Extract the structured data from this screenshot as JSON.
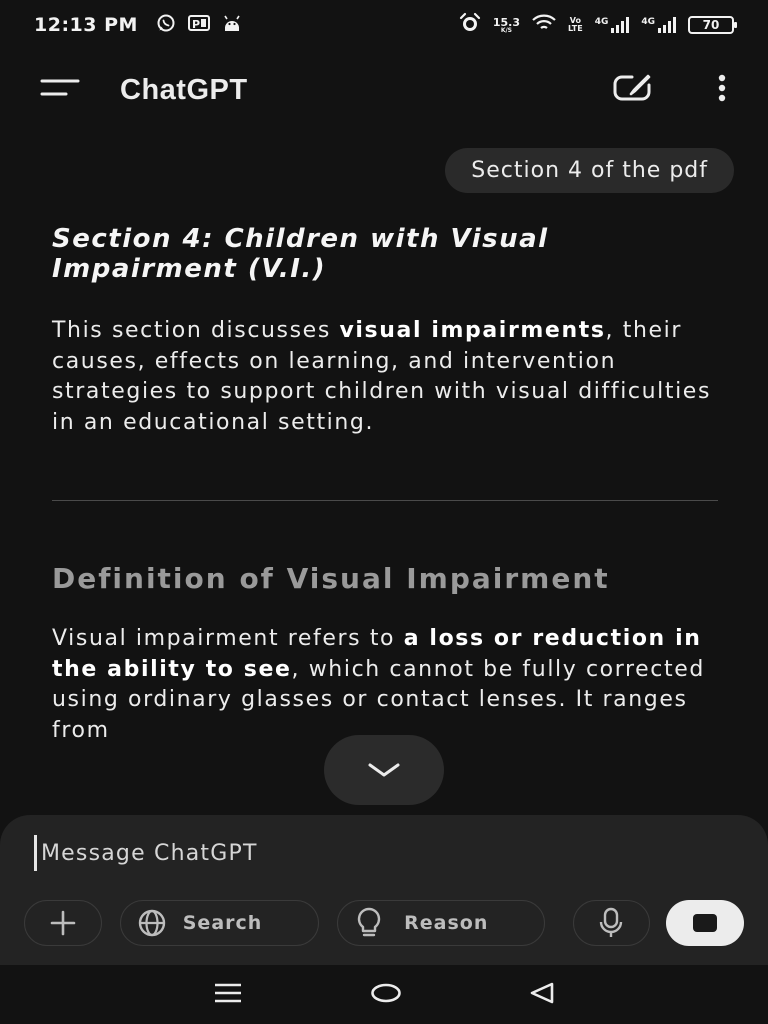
{
  "status_bar": {
    "time": "12:13 PM",
    "speed_value": "15.3",
    "speed_unit": "K/S",
    "volte_top": "Vo",
    "volte_bottom": "LTE",
    "network1": "4G",
    "network2": "4G",
    "battery": "70",
    "icons": [
      "whatsapp-icon",
      "parking-icon",
      "android-icon",
      "alarm-icon",
      "wifi-icon",
      "signal-icon",
      "battery-icon"
    ]
  },
  "app_bar": {
    "title": "ChatGPT",
    "icons": [
      "menu-icon",
      "new-chat-icon",
      "more-vert-icon"
    ]
  },
  "chat": {
    "user_message": "Section 4 of the pdf",
    "response": {
      "heading": "Section 4: Children with Visual Impairment (V.I.)",
      "p1_pre": "This section discusses ",
      "p1_bold": "visual impairments",
      "p1_post": ", their causes, effects on learning, and intervention strategies to support children with visual difficulties in an educational setting.",
      "subheading": "Definition of Visual Impairment",
      "p2_pre": "Visual impairment refers to ",
      "p2_bold": "a loss or reduction in the ability to see",
      "p2_post": ", which cannot be fully corrected using ordinary glasses or contact lenses. It ranges from"
    }
  },
  "composer": {
    "placeholder": "Message ChatGPT",
    "search_label": "Search",
    "reason_label": "Reason"
  },
  "colors": {
    "background": "#121212",
    "composer": "#232323",
    "bubble": "#2a2a2a"
  }
}
